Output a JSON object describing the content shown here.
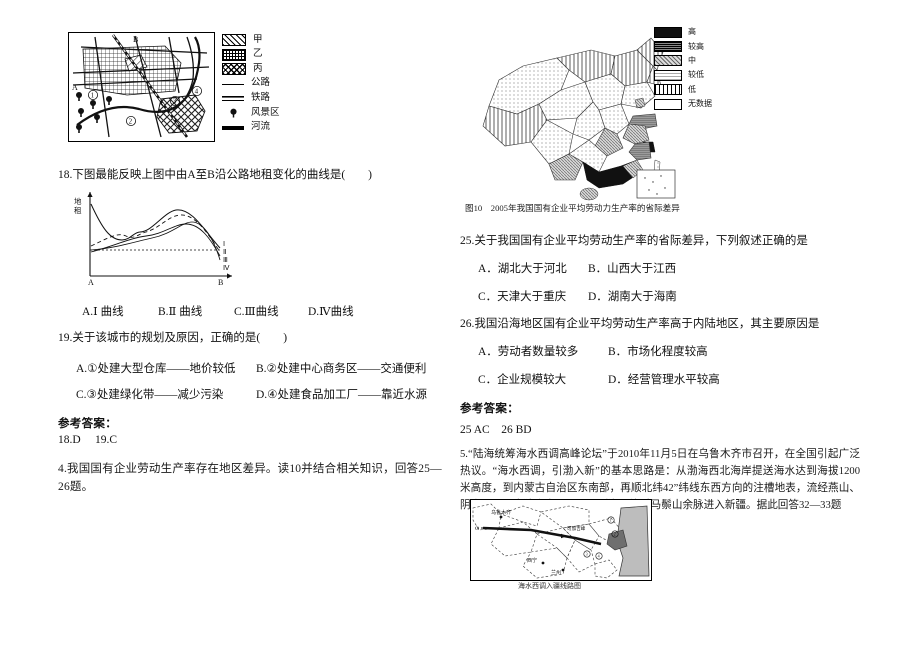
{
  "document": {
    "type": "exam-paper-scan",
    "page_background": "#ffffff",
    "ink_color": "#1a1a1a"
  },
  "left_column": {
    "city_figure": {
      "name": "city-land-use-map",
      "point_labels": [
        "A",
        "B",
        "①",
        "②",
        "③",
        "④"
      ],
      "legend": [
        {
          "symbol": "hatch-diagonal",
          "label": "甲"
        },
        {
          "symbol": "grid-fill",
          "label": "乙"
        },
        {
          "symbol": "cross-hatch",
          "label": "丙"
        },
        {
          "symbol": "solid-line",
          "label": "公路"
        },
        {
          "symbol": "double-line",
          "label": "铁路"
        },
        {
          "symbol": "tree-marker",
          "label": "风景区"
        },
        {
          "symbol": "thick-line",
          "label": "河流"
        }
      ]
    },
    "question_18": {
      "stem": "18.下图最能反映上图中由A至B沿公路地租变化的曲线是(　　)",
      "chart": {
        "y_axis_label": "地租",
        "x_axis_start": "A",
        "x_axis_end": "B",
        "curve_labels": [
          "Ⅰ",
          "Ⅱ",
          "Ⅲ",
          "Ⅳ"
        ]
      },
      "options": [
        "A.Ⅰ 曲线",
        "B.Ⅱ 曲线",
        "C.Ⅲ曲线",
        "D.Ⅳ曲线"
      ]
    },
    "question_19": {
      "stem": "19.关于该城市的规划及原因，正确的是(　　)",
      "options_row1": [
        "A.①处建大型仓库——地价较低",
        "B.②处建中心商务区——交通便利"
      ],
      "options_row2": [
        "C.③处建绿化带——减少污染",
        "D.④处建食品加工厂——靠近水源"
      ]
    },
    "answer_block": {
      "heading": "参考答案：",
      "body": "18.D  19.C"
    },
    "next_item": "4.我国国有企业劳动生产率存在地区差异。读10并结合相关知识，回答25—26题。"
  },
  "right_column": {
    "china_figure": {
      "name": "china-soe-labor-productivity-map",
      "caption": "图10　2005年我国国有企业平均劳动力生产率的省际差异",
      "legend": [
        {
          "symbol": "solid-black",
          "label": "高"
        },
        {
          "symbol": "dense-gray",
          "label": "较高"
        },
        {
          "symbol": "medium-gray",
          "label": "中"
        },
        {
          "symbol": "light-dot",
          "label": "较低"
        },
        {
          "symbol": "vertical-line",
          "label": "低"
        },
        {
          "symbol": "blank",
          "label": "无数据"
        }
      ]
    },
    "question_25": {
      "stem": "25.关于我国国有企业平均劳动生产率的省际差异，下列叙述正确的是",
      "options_row1": [
        "A．湖北大于河北",
        "B．山西大于江西"
      ],
      "options_row2": [
        "C．天津大于重庆",
        "D．湖南大于海南"
      ]
    },
    "question_26": {
      "stem": "26.我国沿海地区国有企业平均劳动生产率高于内陆地区，其主要原因是",
      "options_row1": [
        "A．劳动者数量较多",
        "B．市场化程度较高"
      ],
      "options_row2": [
        "C．企业规模较大",
        "D．经营管理水平较高"
      ]
    },
    "answer_block": {
      "heading": "参考答案：",
      "body": "25 AC　26 BD"
    },
    "question_5": {
      "paragraph": "5.“陆海统筹海水西调高峰论坛”于2010年11月5日在乌鲁木齐市召开，在全国引起广泛热议。“海水西调，引渤入新”的基本思路是：从渤海西北海岸提送海水达到海拔1200米高度，到内蒙古自治区东南部，再顺北纬42”纬线东西方向的注槽地表，流经燕山、阴山以北，出狼山向西进入居延海，绕过马鬃山余脉进入新疆。据此回答32—33题",
      "figure": {
        "name": "seawater-west-diversion-route-map",
        "caption": "海水西调入疆线路图",
        "city_labels": [
          "乌鲁木齐",
          "西宁",
          "兰州"
        ],
        "point_labels": [
          "C",
          "①",
          "②",
          "③",
          "④"
        ],
        "feature_label": "可加吉峰"
      }
    }
  }
}
